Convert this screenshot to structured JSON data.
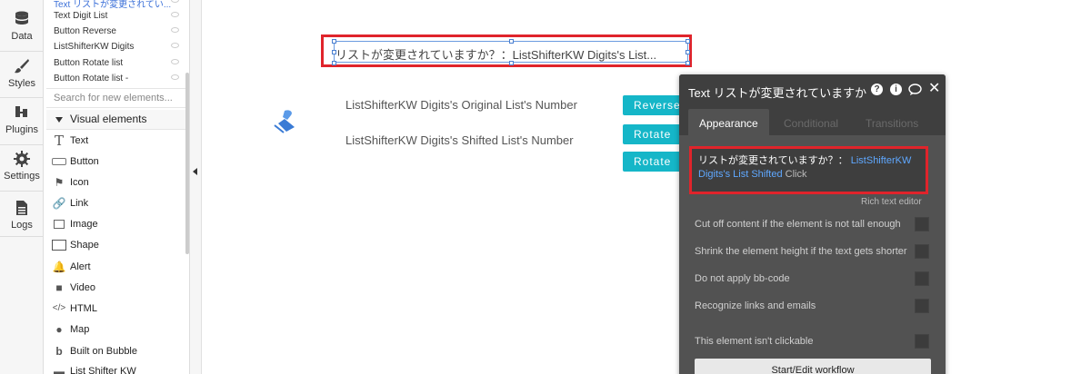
{
  "iconbar": {
    "items": [
      {
        "label": "Data",
        "icon": "database-icon"
      },
      {
        "label": "Styles",
        "icon": "brush-icon"
      },
      {
        "label": "Plugins",
        "icon": "plug-icon"
      },
      {
        "label": "Settings",
        "icon": "gear-icon"
      },
      {
        "label": "Logs",
        "icon": "document-icon"
      }
    ]
  },
  "element_tree": {
    "items": [
      {
        "label": "Text リストが変更されてい...",
        "highlighted": true
      },
      {
        "label": "Text Digit List",
        "highlighted": false
      },
      {
        "label": "Button Reverse",
        "highlighted": false
      },
      {
        "label": "ListShifterKW Digits",
        "highlighted": false
      },
      {
        "label": "Button Rotate list",
        "highlighted": false
      },
      {
        "label": "Button Rotate list -",
        "highlighted": false
      }
    ]
  },
  "palette": {
    "search_placeholder": "Search for new elements...",
    "section_title": "Visual elements",
    "items": [
      {
        "label": "Text",
        "icon": "text-icon"
      },
      {
        "label": "Button",
        "icon": "button-icon"
      },
      {
        "label": "Icon",
        "icon": "flag-icon"
      },
      {
        "label": "Link",
        "icon": "link-icon"
      },
      {
        "label": "Image",
        "icon": "image-icon"
      },
      {
        "label": "Shape",
        "icon": "shape-icon"
      },
      {
        "label": "Alert",
        "icon": "bell-icon"
      },
      {
        "label": "Video",
        "icon": "video-icon"
      },
      {
        "label": "HTML",
        "icon": "code-icon"
      },
      {
        "label": "Map",
        "icon": "map-pin-icon"
      },
      {
        "label": "Built on Bubble",
        "icon": "bubble-logo-icon"
      },
      {
        "label": "List Shifter KW",
        "icon": "list-icon"
      }
    ]
  },
  "canvas": {
    "selected_text": "リストが変更されていますか？：ListShifterKW Digits's List...",
    "label_original": "ListShifterKW Digits's Original List's Number",
    "label_shifted": "ListShifterKW Digits's Shifted List's Number",
    "buttons": [
      "Reverse",
      "Rotate",
      "Rotate"
    ]
  },
  "property_editor": {
    "title": "Text リストが変更されていますか",
    "tabs": [
      "Appearance",
      "Conditional",
      "Transitions"
    ],
    "content_static": "リストが変更されていますか？：",
    "content_dynamic": "ListShifterKW Digits's List Shifted",
    "content_click": "Click",
    "rich_text_editor": "Rich text editor",
    "options": [
      "Cut off content if the element is not tall enough",
      "Shrink the element height if the text gets shorter",
      "Do not apply bb-code",
      "Recognize links and emails",
      "This element isn't clickable"
    ],
    "workflow_button": "Start/Edit workflow"
  },
  "colors": {
    "accent_button": "#15b6c8",
    "highlight_outline": "#e0242b",
    "editor_background": "#525252",
    "dynamic_text": "#5fa8ff"
  }
}
